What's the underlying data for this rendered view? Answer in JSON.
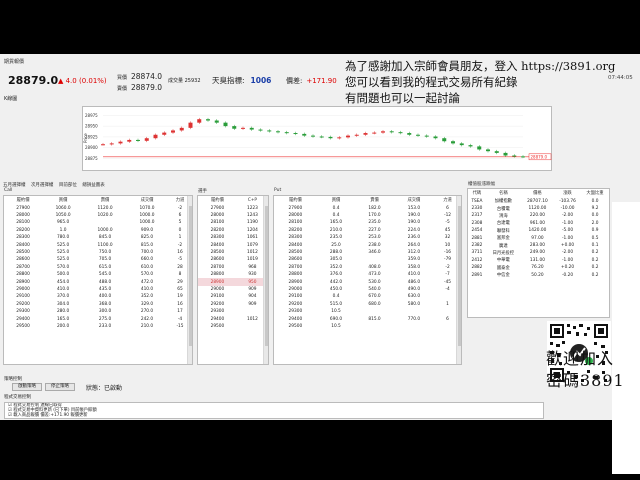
{
  "window": {
    "title": "期貨報價"
  },
  "overlay": {
    "line1": "為了感謝加入宗師會員朋友，登入 https://3891.org",
    "line2": "您可以看到我的程式交易所有紀錄",
    "line3": "有問題也可以一起討論"
  },
  "quote": {
    "price": "28879.0",
    "change": "▲ 4.0 (0.01%)",
    "bid_label": "買價",
    "bid": "28874.0",
    "ask_label": "賣價",
    "ask": "28879.0",
    "volume_label": "成交量",
    "volume": "25932",
    "sky_label": "天臭指標:",
    "sky_value": "1006",
    "basis_label": "價差:",
    "basis_value": "+171.90",
    "time": "07:44:05"
  },
  "chart_label": "K線圖",
  "chart_data": {
    "type": "line",
    "ylabel": "Price",
    "yticks": [
      "28975",
      "28950",
      "28925",
      "28900",
      "28875"
    ],
    "ylim": [
      28860,
      28985
    ],
    "last_label": "28879.0",
    "y": [
      28908,
      28910,
      28914,
      28918,
      28916,
      28922,
      28930,
      28935,
      28940,
      28946,
      28958,
      28966,
      28963,
      28958,
      28950,
      28944,
      28946,
      28942,
      28940,
      28938,
      28936,
      28934,
      28932,
      28928,
      28926,
      28925,
      28922,
      28924,
      28928,
      28930,
      28934,
      28935,
      28938,
      28936,
      28934,
      28930,
      28928,
      28926,
      28922,
      28915,
      28910,
      28906,
      28903,
      28896,
      28892,
      28888,
      28882,
      28880,
      28879
    ]
  },
  "tabs": [
    "五月選擇權",
    "次月選擇權",
    "目前部位",
    "總損益圖表"
  ],
  "call": {
    "title": "Call",
    "headers": [
      "履約價",
      "買價",
      "賣價",
      "成交價",
      "力道"
    ],
    "rows": [
      [
        "27900",
        "1060.0",
        "1120.0",
        "1070.0",
        "-2"
      ],
      [
        "28000",
        "1050.0",
        "1020.0",
        "1000.0",
        "6"
      ],
      [
        "28100",
        "965.0",
        "",
        "1000.0",
        "5"
      ],
      [
        "28200",
        "1.0",
        "1000.0",
        "909.0",
        "0"
      ],
      [
        "28300",
        "780.0",
        "845.0",
        "825.0",
        "1"
      ],
      [
        "28400",
        "525.0",
        "1100.0",
        "815.0",
        "-2"
      ],
      [
        "28500",
        "525.0",
        "750.0",
        "700.0",
        "16"
      ],
      [
        "28600",
        "525.0",
        "705.0",
        "660.0",
        "-5"
      ],
      [
        "28700",
        "570.0",
        "615.0",
        "610.0",
        "28"
      ],
      [
        "28800",
        "500.0",
        "545.0",
        "570.0",
        "8"
      ],
      [
        "28900",
        "454.0",
        "488.0",
        "472.0",
        "29"
      ],
      [
        "29000",
        "410.0",
        "435.0",
        "410.0",
        "65"
      ],
      [
        "29100",
        "370.0",
        "400.0",
        "352.0",
        "19"
      ],
      [
        "29200",
        "304.0",
        "368.0",
        "329.0",
        "16"
      ],
      [
        "29300",
        "280.0",
        "300.0",
        "270.0",
        "17"
      ],
      [
        "29400",
        "165.0",
        "275.0",
        "242.0",
        "-4"
      ],
      [
        "29500",
        "200.0",
        "233.0",
        "210.0",
        "-15"
      ]
    ]
  },
  "mid": {
    "title": "選手",
    "headers": [
      "履約價",
      "C+P"
    ],
    "rows": [
      [
        "27900",
        "1223"
      ],
      [
        "28000",
        "1243"
      ],
      [
        "28100",
        "1190"
      ],
      [
        "28200",
        "1204"
      ],
      [
        "28300",
        "1061"
      ],
      [
        "28400",
        "1079"
      ],
      [
        "28500",
        "1012"
      ],
      [
        "28600",
        "1019"
      ],
      [
        "28700",
        "968"
      ],
      [
        "28800",
        "930"
      ],
      [
        "28900",
        "950"
      ],
      [
        "29000",
        "909"
      ],
      [
        "29100",
        "904"
      ],
      [
        "29200",
        "909"
      ],
      [
        "29300",
        ""
      ],
      [
        "29400",
        "1012"
      ],
      [
        "29500",
        "",
        ""
      ]
    ],
    "selected_index": 10
  },
  "put": {
    "title": "Put",
    "headers": [
      "履約價",
      "買價",
      "賣價",
      "成交價",
      "力道"
    ],
    "rows": [
      [
        "27900",
        "0.4",
        "182.0",
        "153.0",
        "6"
      ],
      [
        "28000",
        "0.4",
        "170.0",
        "190.0",
        "-12"
      ],
      [
        "28100",
        "165.0",
        "235.0",
        "190.0",
        "-5"
      ],
      [
        "28200",
        "210.0",
        "227.0",
        "224.0",
        "45"
      ],
      [
        "28300",
        "235.0",
        "253.0",
        "236.0",
        "32"
      ],
      [
        "28400",
        "25.0",
        "238.0",
        "264.0",
        "10"
      ],
      [
        "28500",
        "288.0",
        "346.0",
        "312.0",
        "-16"
      ],
      [
        "28600",
        "305.0",
        "",
        "359.0",
        "-79"
      ],
      [
        "28700",
        "352.0",
        "408.0",
        "358.0",
        "-2"
      ],
      [
        "28800",
        "376.0",
        "473.0",
        "410.0",
        "-7"
      ],
      [
        "28900",
        "442.0",
        "530.0",
        "486.0",
        "-45"
      ],
      [
        "29000",
        "450.0",
        "540.0",
        "490.0",
        "-4"
      ],
      [
        "29100",
        "0.4",
        "670.0",
        "630.0",
        ""
      ],
      [
        "29200",
        "515.0",
        "680.0",
        "580.0",
        "1"
      ],
      [
        "29300",
        "10.5",
        "",
        "",
        ""
      ],
      [
        "29400",
        "690.0",
        "815.0",
        "770.0",
        "6"
      ],
      [
        "29500",
        "10.5",
        "",
        "",
        ""
      ]
    ]
  },
  "stocks": {
    "title": "權值股漲跌幅",
    "headers": [
      "代碼",
      "名稱",
      "價格",
      "漲跌",
      "大盤比重"
    ],
    "rows": [
      [
        "TSEA",
        "加權指數",
        "28707.10",
        "-103.76",
        "0.0"
      ],
      [
        "2330",
        "台積電",
        "1120.00",
        "-10.00",
        "9.2"
      ],
      [
        "2317",
        "鴻海",
        "220.00",
        "-2.00",
        "0.0"
      ],
      [
        "2308",
        "台達電",
        "961.00",
        "-1.00",
        "2.0"
      ],
      [
        "2454",
        "聯發科",
        "1420.00",
        "-5.00",
        "0.9"
      ],
      [
        "2881",
        "富邦金",
        "97.00",
        "-1.00",
        "0.5"
      ],
      [
        "2382",
        "廣達",
        "283.00",
        "+0.00",
        "0.1"
      ],
      [
        "3711",
        "日月光投控",
        "249.00",
        "-2.00",
        "0.2"
      ],
      [
        "2412",
        "中華電",
        "131.00",
        "-1.00",
        "0.2"
      ],
      [
        "2882",
        "國泰金",
        "76.20",
        "+0.20",
        "0.2"
      ],
      [
        "2891",
        "中信金",
        "50.20",
        "-0.20",
        "0.2"
      ]
    ]
  },
  "strategy": {
    "label": "策略控制",
    "start_button": "啟動策略",
    "stop_button": "停止策略",
    "status": "狀態：已啟動"
  },
  "log": {
    "label": "程式交易控制",
    "lines": [
      "☑ 程式交易控制 連線已取得",
      "☑ 程式交易中資料更新 (已下單) 目前帳戶餘額",
      "☑ 載入商品報價 價差:+171.90 報價更新",
      "☑ 載入歷史資料",
      "狀態 (已開啟)"
    ]
  },
  "promo": {
    "line1": "歡迎加入",
    "line2": "密碼3891"
  }
}
